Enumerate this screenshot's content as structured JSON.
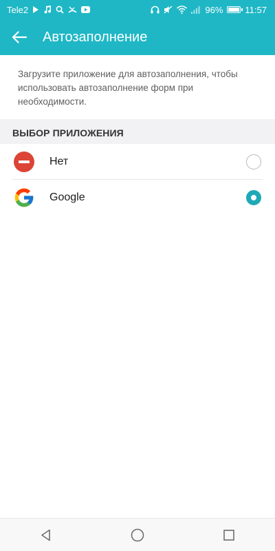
{
  "status_bar": {
    "carrier": "Tele2",
    "battery_percent_label": "96%",
    "battery_level": 0.96,
    "time": "11:57",
    "left_icons": [
      "play-icon",
      "music-icon",
      "search-icon",
      "missed-call-icon",
      "youtube-icon"
    ],
    "right_icons": [
      "headphones-icon",
      "mute-icon",
      "wifi-icon",
      "signal-icon",
      "battery-icon"
    ]
  },
  "app_bar": {
    "title": "Автозаполнение",
    "back_icon": "arrow-back-icon"
  },
  "description": "Загрузите приложение для автозаполнения, чтобы использовать автозаполнение форм при необходимости.",
  "section": {
    "header": "ВЫБОР ПРИЛОЖЕНИЯ",
    "items": [
      {
        "label": "Нет",
        "icon": "none-icon",
        "selected": false
      },
      {
        "label": "Google",
        "icon": "google-icon",
        "selected": true
      }
    ]
  },
  "nav_bar": {
    "buttons": [
      "back-triangle-icon",
      "home-circle-icon",
      "recents-square-icon"
    ]
  },
  "colors": {
    "accent": "#1fb7c5",
    "radio_selected": "#1fa9b7",
    "section_bg": "#f2f2f4",
    "none_icon_red": "#db4437"
  }
}
